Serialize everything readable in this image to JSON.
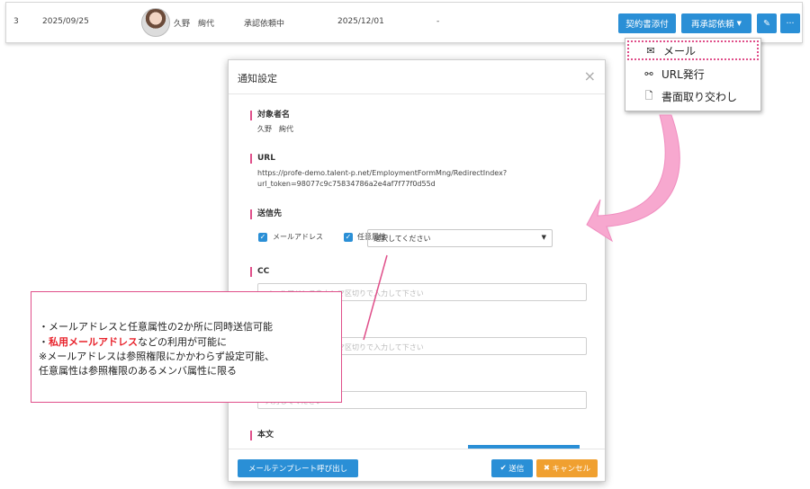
{
  "row": {
    "index": "3",
    "date": "2025/09/25",
    "name": "久野　絢代",
    "status": "承認依頼中",
    "due": "2025/12/01",
    "dash": "-",
    "attach_button": "契約書添付",
    "reapprove_button": "再承認依頼",
    "edit_icon": "✎",
    "more_icon": "···"
  },
  "dropdown": {
    "items": [
      {
        "icon": "✉",
        "label": "メール"
      },
      {
        "icon": "⚯",
        "label": "URL発行"
      },
      {
        "icon": "🗋",
        "label": "書面取り交わし"
      }
    ]
  },
  "modal": {
    "title": "通知設定",
    "close": "×",
    "target_label": "対象者名",
    "target_value": "久野　絢代",
    "url_label": "URL",
    "url_line1": "https://profe-demo.talent-p.net/EmploymentFormMng/RedirectIndex?",
    "url_line2": "url_token=98077c9c75834786a2e4af7f77f0d55d",
    "send_to_label": "送信先",
    "email_checkbox": "メールアドレス",
    "attr_checkbox": "任意属性",
    "select_placeholder": "選択してください",
    "cc_label": "CC",
    "cc_placeholder": "メールアドレスをカンマ区切りで入力して下さい",
    "bcc_placeholder": "メールアドレスをカンマ区切りで入力して下さい",
    "field3_placeholder": "入力してください",
    "body_label": "本文",
    "template_button": "メールテンプレート呼び出し",
    "send_button": "送信",
    "cancel_button": "キャンセル"
  },
  "note": {
    "line1": "・メールアドレスと任意属性の2か所に同時送信可能",
    "line2_prefix": "・",
    "line2_highlight": "私用メールアドレス",
    "line2_suffix": "などの利用が可能に",
    "line3": "※メールアドレスは参照権限にかかわらず設定可能、",
    "line4": "任意属性は参照権限のあるメンバ属性に限る"
  },
  "colors": {
    "accent": "#2a8fd6",
    "pink": "#e04f8a",
    "orange": "#f0a030",
    "highlight_red": "#e8222b"
  }
}
